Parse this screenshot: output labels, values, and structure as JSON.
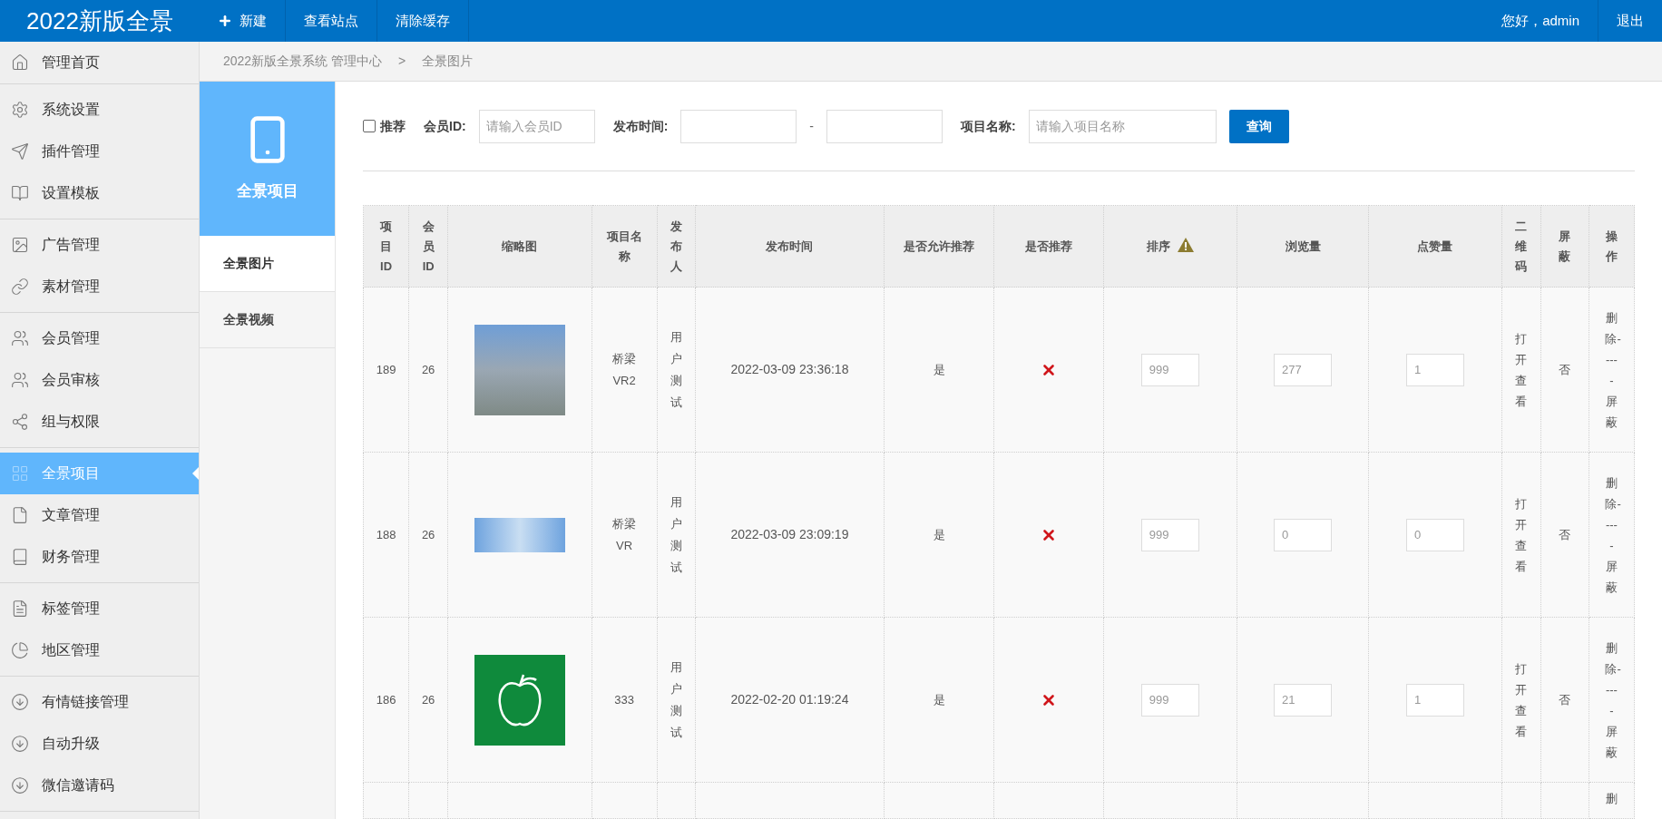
{
  "topbar": {
    "logo": "2022新版全景",
    "nav": [
      {
        "label": "新建",
        "kind": "add"
      },
      {
        "label": "查看站点",
        "kind": "plain"
      },
      {
        "label": "清除缓存",
        "kind": "plain"
      }
    ],
    "greeting": "您好，admin",
    "logout": "退出"
  },
  "sidebar": {
    "groups": [
      {
        "items": [
          {
            "label": "管理首页",
            "selected": false
          }
        ]
      },
      {
        "items": [
          {
            "label": "系统设置",
            "selected": false
          },
          {
            "label": "插件管理",
            "selected": false
          },
          {
            "label": "设置模板",
            "selected": false
          }
        ]
      },
      {
        "items": [
          {
            "label": "广告管理",
            "selected": false
          },
          {
            "label": "素材管理",
            "selected": false
          }
        ]
      },
      {
        "items": [
          {
            "label": "会员管理",
            "selected": false
          },
          {
            "label": "会员审核",
            "selected": false
          },
          {
            "label": "组与权限",
            "selected": false
          }
        ]
      },
      {
        "items": [
          {
            "label": "全景项目",
            "selected": true
          },
          {
            "label": "文章管理",
            "selected": false
          },
          {
            "label": "财务管理",
            "selected": false
          }
        ]
      },
      {
        "items": [
          {
            "label": "标签管理",
            "selected": false
          },
          {
            "label": "地区管理",
            "selected": false
          }
        ]
      },
      {
        "items": [
          {
            "label": "有情链接管理",
            "selected": false
          },
          {
            "label": "自动升级",
            "selected": false
          },
          {
            "label": "微信邀请码",
            "selected": false
          }
        ]
      }
    ]
  },
  "breadcrumb": {
    "items": [
      "2022新版全景系统 管理中心",
      "全景图片"
    ],
    "separator": ">"
  },
  "subnav": {
    "title": "全景项目",
    "items": [
      {
        "label": "全景图片",
        "selected": true
      },
      {
        "label": "全景视频",
        "selected": false
      }
    ]
  },
  "filter": {
    "recommend": {
      "label": "推荐",
      "checked": false
    },
    "member_id": {
      "label": "会员ID:",
      "placeholder": "请输入会员ID"
    },
    "publish_time": {
      "label": "发布时间:",
      "separator": "-"
    },
    "project_name": {
      "label": "项目名称:",
      "placeholder": "请输入项目名称"
    },
    "search_button": "查询"
  },
  "table": {
    "columns": [
      "项目ID",
      "会员ID",
      "缩略图",
      "项目名称",
      "发布人",
      "发布时间",
      "是否允许推荐",
      "是否推荐",
      "排序",
      "浏览量",
      "点赞量",
      "二维码",
      "屏蔽",
      "操作"
    ],
    "rows": [
      {
        "id": "189",
        "member_id": "26",
        "thumbnail": {
          "kind": "photo"
        },
        "name": "桥梁VR2",
        "publisher": "用户测试",
        "time": "2022-03-09 23:36:18",
        "allow": "是",
        "recommended": false,
        "sort": "999",
        "views": "277",
        "likes": "1",
        "qr": "打开查看",
        "blocked": "否",
        "action": "删除-----屏蔽"
      },
      {
        "id": "188",
        "member_id": "26",
        "thumbnail": {
          "kind": "banner"
        },
        "name": "桥梁VR",
        "publisher": "用户测试",
        "time": "2022-03-09 23:09:19",
        "allow": "是",
        "recommended": false,
        "sort": "999",
        "views": "0",
        "likes": "0",
        "qr": "打开查看",
        "blocked": "否",
        "action": "删除-----屏蔽"
      },
      {
        "id": "186",
        "member_id": "26",
        "thumbnail": {
          "kind": "logo"
        },
        "name": "333",
        "publisher": "用户测试",
        "time": "2022-02-20 01:19:24",
        "allow": "是",
        "recommended": false,
        "sort": "999",
        "views": "21",
        "likes": "1",
        "qr": "打开查看",
        "blocked": "否",
        "action": "删除-----屏蔽"
      }
    ],
    "partial_row_action": "删"
  }
}
